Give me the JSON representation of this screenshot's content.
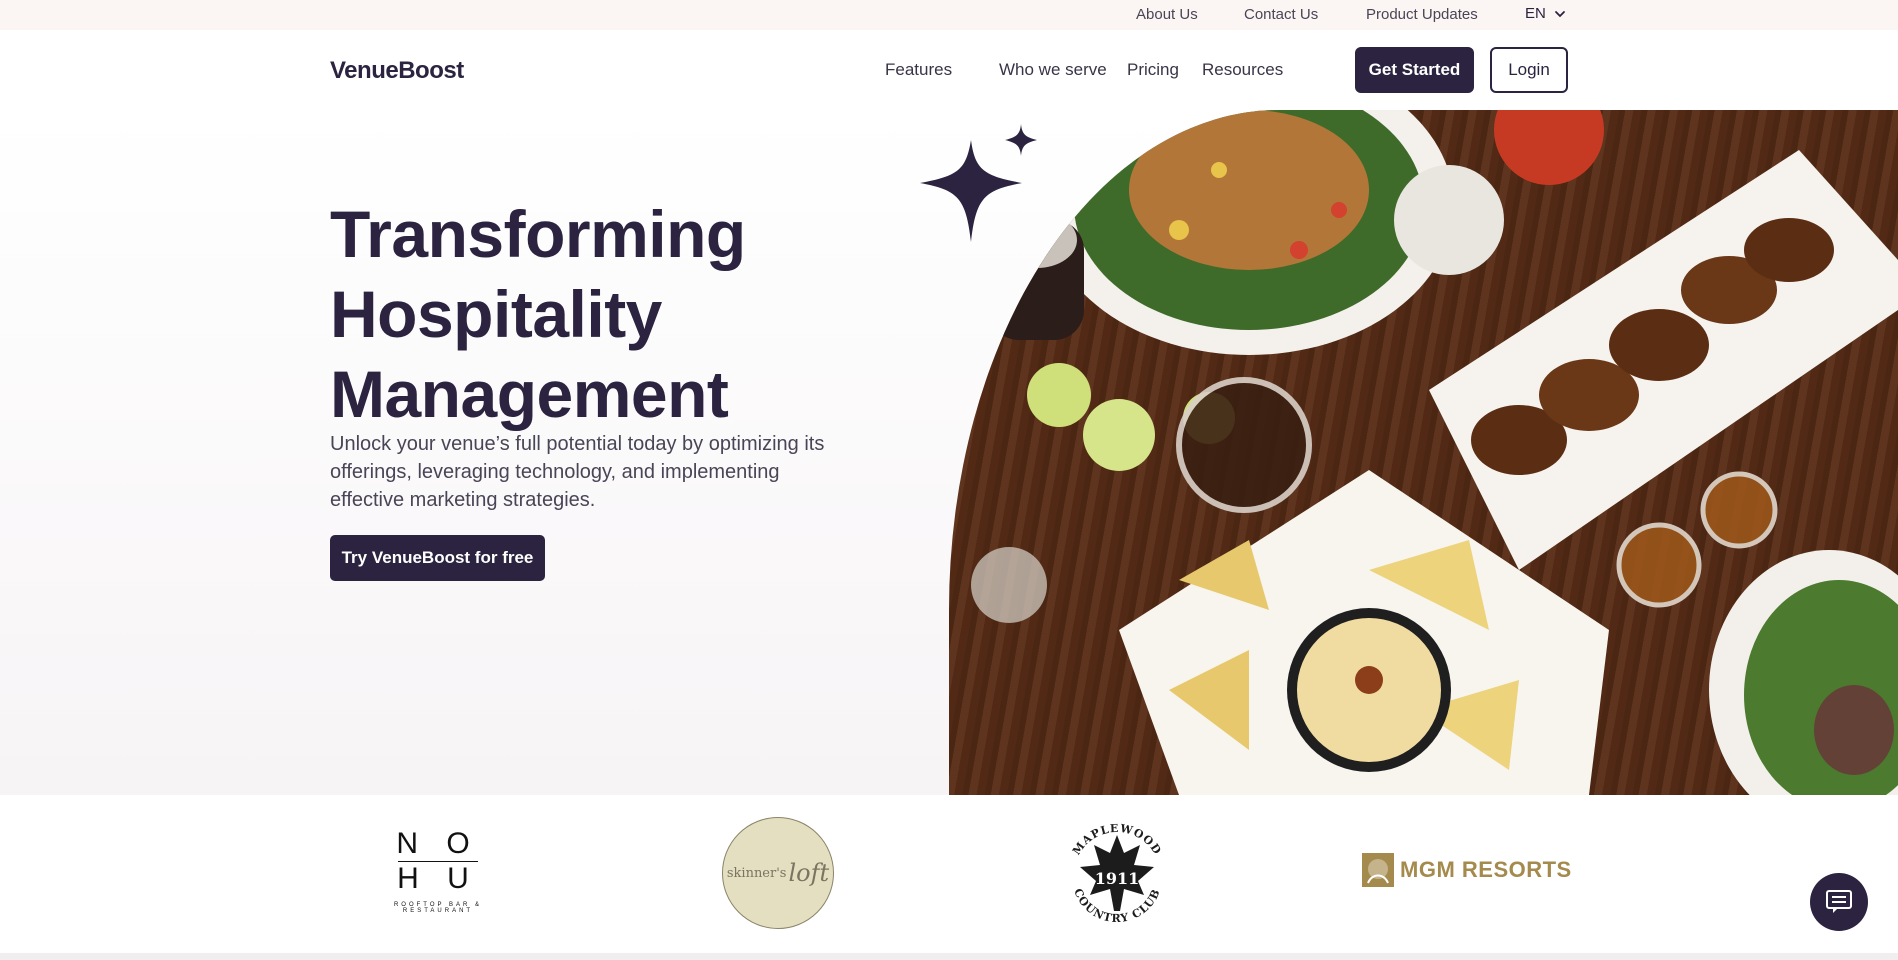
{
  "topbar": {
    "links": [
      "About Us",
      "Contact Us",
      "Product Updates"
    ],
    "language": "EN"
  },
  "nav": {
    "logo": "VenueBoost",
    "links": [
      "Features",
      "Who we serve",
      "Pricing",
      "Resources"
    ],
    "get_started": "Get Started",
    "login": "Login"
  },
  "hero": {
    "title": "Transforming Hospitality Management",
    "subtitle": "Unlock your venue’s full potential today by optimizing its offerings, leveraging technology, and implementing effective marketing strategies.",
    "cta": "Try VenueBoost for free"
  },
  "clients": {
    "nohu": {
      "line1": "N O",
      "line2": "H U",
      "tagline": "ROOFTOP BAR & RESTAURANT"
    },
    "skinners": {
      "name": "skinner's",
      "script": "loft"
    },
    "maplewood": {
      "top": "MAPLEWOOD",
      "year": "1911",
      "bottom": "COUNTRY CLUB"
    },
    "mgm": {
      "name": "MGM RESORTS"
    }
  },
  "colors": {
    "brand_dark": "#2b2340",
    "topbar_bg": "#fbf6f3",
    "mgm_gold": "#a58a4d",
    "skinners_bg": "#e5dfc1"
  },
  "icons": {
    "language_dropdown": "chevron-down-icon",
    "chat": "chat-icon",
    "hero_decor": "sparkle-icon"
  }
}
